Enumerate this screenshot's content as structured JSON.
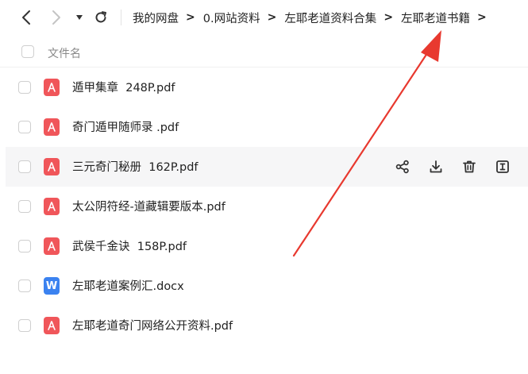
{
  "nav": {
    "back": "back-icon",
    "forward": "forward-icon",
    "dropdown": "caret-down-icon",
    "refresh": "refresh-icon"
  },
  "breadcrumb": {
    "items": [
      "我的网盘",
      "0.网站资料",
      "左耶老道资料合集",
      "左耶老道书籍"
    ],
    "separator": ">"
  },
  "list_header": {
    "name_label": "文件名"
  },
  "files": [
    {
      "name": "遁甲集章  248P.pdf",
      "type": "pdf"
    },
    {
      "name": "奇门遁甲随师录 .pdf",
      "type": "pdf"
    },
    {
      "name": "三元奇门秘册  162P.pdf",
      "type": "pdf"
    },
    {
      "name": "太公阴符经-道藏辑要版本.pdf",
      "type": "pdf"
    },
    {
      "name": "武侯千金诀  158P.pdf",
      "type": "pdf"
    },
    {
      "name": "左耶老道案例汇.docx",
      "type": "docx",
      "icon_letter": "W"
    },
    {
      "name": "左耶老道奇门网络公开资料.pdf",
      "type": "pdf"
    }
  ],
  "row_actions": [
    "share-icon",
    "download-icon",
    "delete-icon",
    "rename-icon"
  ],
  "colors": {
    "pdf": "#f0565a",
    "docx": "#3b82f0",
    "arrow": "#e8392f",
    "hover_row": "#f6f6f7"
  }
}
